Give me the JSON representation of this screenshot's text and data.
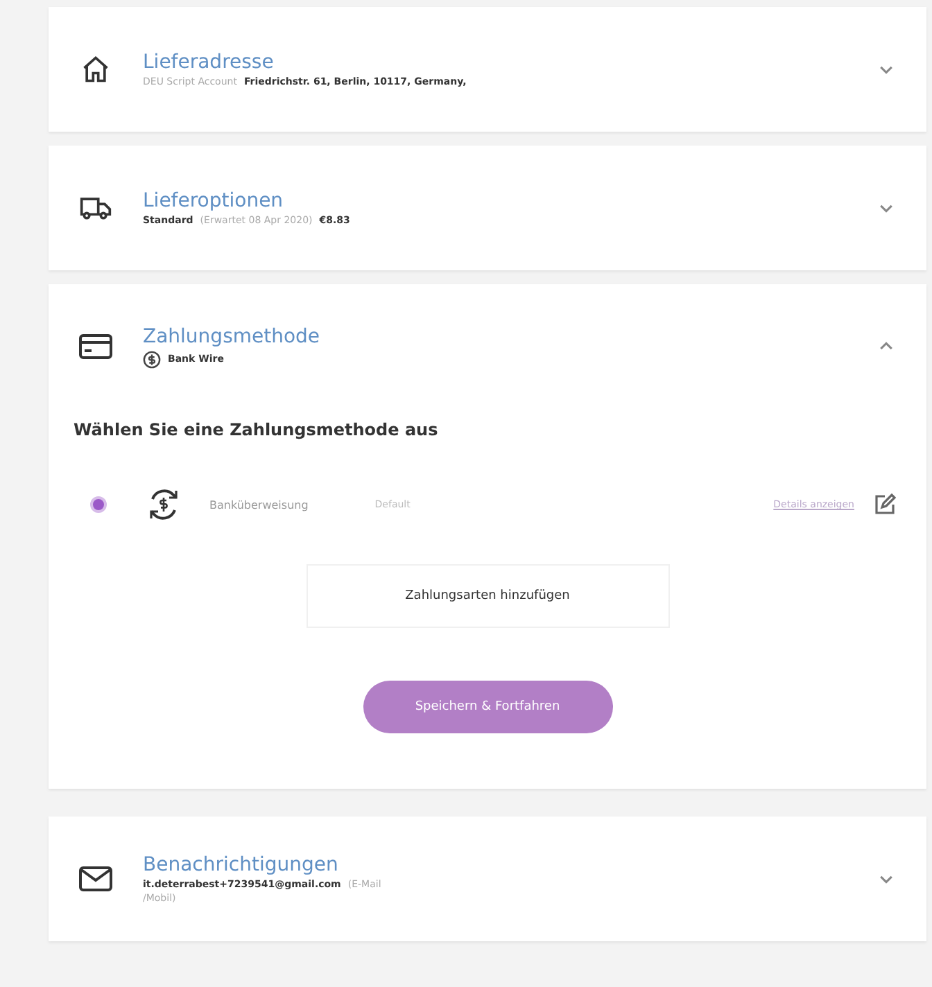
{
  "sections": [
    {
      "title": "Lieferadresse",
      "expanded": false,
      "summary": [
        {
          "text": "DEU Script Account",
          "strong": false
        },
        {
          "text": "Friedrichstr. 61, Berlin, 10117, Germany,",
          "strong": true
        }
      ]
    },
    {
      "title": "Lieferoptionen",
      "expanded": false,
      "summary": [
        {
          "text": "Standard",
          "strong": true
        },
        {
          "text": "(Erwartet 08 Apr 2020)",
          "strong": false
        },
        {
          "text": "€8.83",
          "strong": true
        }
      ]
    },
    {
      "title": "Zahlungsmethode",
      "expanded": true,
      "summary": [
        {
          "text": "Bank Wire",
          "strong": true
        }
      ],
      "body": {
        "heading": "Wählen Sie eine Zahlungsmethode aus",
        "methods": [
          {
            "name": "Banküberweisung",
            "badge": "Default",
            "link": "Details anzeigen",
            "selected": true
          }
        ],
        "add_button": "Zahlungsarten hinzufügen",
        "save_button": {
          "label": "Speichern & Fortfahren",
          "disabled": true
        }
      }
    },
    {
      "title": "Benachrichtigungen",
      "expanded": false,
      "summary": [
        {
          "text": "it.deterrabest+7239541@gmail.com",
          "strong": true
        },
        {
          "text": "(E-Mail",
          "strong": false
        }
      ],
      "summary_line2": "/Mobil)"
    }
  ]
}
